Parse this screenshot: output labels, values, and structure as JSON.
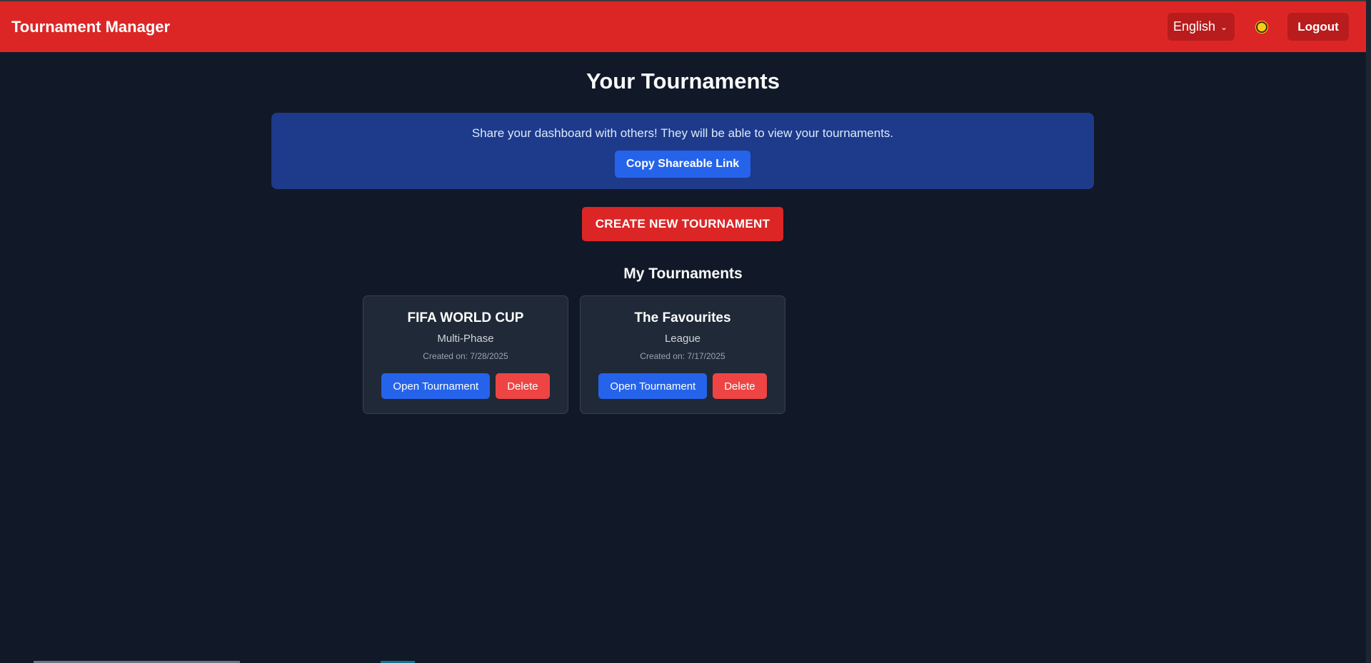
{
  "header": {
    "brand": "Tournament Manager",
    "language": "English",
    "theme_icon": "sun-icon",
    "logout_label": "Logout"
  },
  "main": {
    "title": "Your Tournaments",
    "share": {
      "message": "Share your dashboard with others! They will be able to view your tournaments.",
      "button_label": "Copy Shareable Link"
    },
    "create_label": "CREATE NEW TOURNAMENT",
    "section_title": "My Tournaments",
    "tournaments": [
      {
        "name": "FIFA WORLD CUP",
        "type": "Multi-Phase",
        "created": "Created on: 7/28/2025",
        "open_label": "Open Tournament",
        "delete_label": "Delete"
      },
      {
        "name": "The Favourites",
        "type": "League",
        "created": "Created on: 7/17/2025",
        "open_label": "Open Tournament",
        "delete_label": "Delete"
      }
    ]
  },
  "colors": {
    "header": "#dc2626",
    "background": "#111827",
    "share_panel": "#1e3a8a",
    "primary": "#2563eb",
    "danger": "#ef4444",
    "card": "#1f2937"
  }
}
